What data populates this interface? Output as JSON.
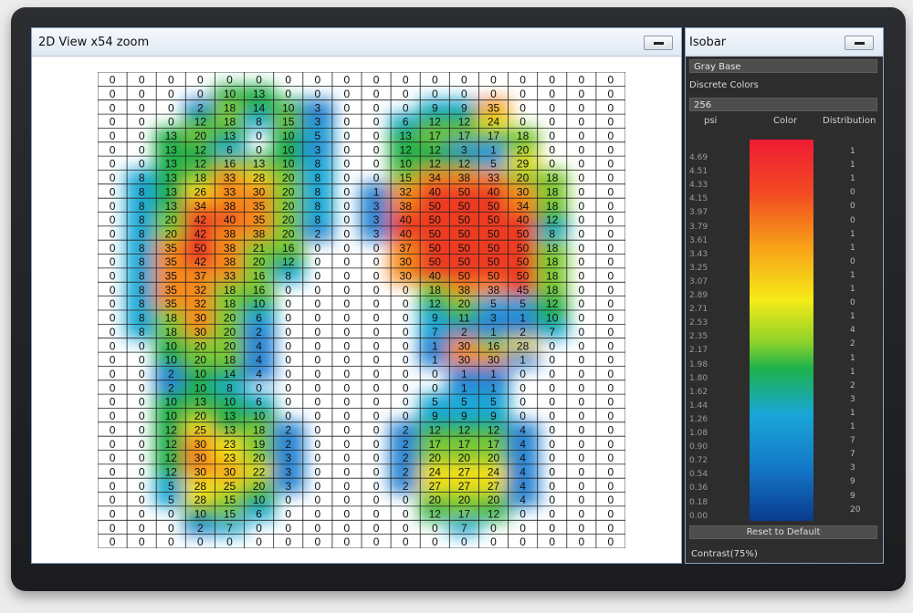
{
  "view_window": {
    "title": "2D View  x54 zoom",
    "grid": {
      "cols": 18,
      "left_region_cols": [
        0,
        8
      ],
      "rows": [
        [
          "0",
          "0",
          "0",
          "0",
          "0",
          "0",
          "0",
          "0",
          "0",
          "0",
          "0",
          "0",
          "0",
          "0",
          "0",
          "0",
          "0",
          "0"
        ],
        [
          "0",
          "0",
          "0",
          "0",
          "10",
          "13",
          "0",
          "0",
          "0",
          "0",
          "0",
          "0",
          "0",
          "0",
          "0",
          "0",
          "0",
          "0"
        ],
        [
          "0",
          "0",
          "0",
          "2",
          "18",
          "14",
          "10",
          "3",
          "0",
          "0",
          "0",
          "9",
          "9",
          "35",
          "0",
          "0",
          "0",
          "0"
        ],
        [
          "0",
          "0",
          "0",
          "12",
          "18",
          "8",
          "15",
          "3",
          "0",
          "0",
          "6",
          "12",
          "12",
          "24",
          "0",
          "0",
          "0",
          "0"
        ],
        [
          "0",
          "0",
          "13",
          "20",
          "13",
          "0",
          "10",
          "5",
          "0",
          "0",
          "13",
          "17",
          "17",
          "17",
          "18",
          "0",
          "0",
          "0"
        ],
        [
          "0",
          "0",
          "13",
          "12",
          "6",
          "0",
          "10",
          "3",
          "0",
          "0",
          "12",
          "12",
          "3",
          "1",
          "20",
          "0",
          "0",
          "0"
        ],
        [
          "0",
          "0",
          "13",
          "12",
          "16",
          "13",
          "10",
          "8",
          "0",
          "0",
          "10",
          "12",
          "12",
          "5",
          "29",
          "0",
          "0",
          "0"
        ],
        [
          "0",
          "8",
          "13",
          "18",
          "33",
          "28",
          "20",
          "8",
          "0",
          "0",
          "15",
          "34",
          "38",
          "33",
          "20",
          "18",
          "0",
          "0"
        ],
        [
          "0",
          "8",
          "13",
          "26",
          "33",
          "30",
          "20",
          "8",
          "0",
          "1",
          "32",
          "40",
          "50",
          "40",
          "30",
          "18",
          "0",
          "0"
        ],
        [
          "0",
          "8",
          "13",
          "34",
          "38",
          "35",
          "20",
          "8",
          "0",
          "3",
          "38",
          "50",
          "50",
          "50",
          "34",
          "18",
          "0",
          "0"
        ],
        [
          "0",
          "8",
          "20",
          "42",
          "40",
          "35",
          "20",
          "8",
          "0",
          "3",
          "40",
          "50",
          "50",
          "50",
          "40",
          "12",
          "0",
          "0"
        ],
        [
          "0",
          "8",
          "20",
          "42",
          "38",
          "38",
          "20",
          "2",
          "0",
          "3",
          "40",
          "50",
          "50",
          "50",
          "50",
          "8",
          "0",
          "0"
        ],
        [
          "0",
          "8",
          "35",
          "50",
          "38",
          "21",
          "16",
          "0",
          "0",
          "0",
          "37",
          "50",
          "50",
          "50",
          "50",
          "18",
          "0",
          "0"
        ],
        [
          "0",
          "8",
          "35",
          "42",
          "38",
          "20",
          "12",
          "0",
          "0",
          "0",
          "30",
          "50",
          "50",
          "50",
          "50",
          "18",
          "0",
          "0"
        ],
        [
          "0",
          "8",
          "35",
          "37",
          "33",
          "16",
          "8",
          "0",
          "0",
          "0",
          "30",
          "40",
          "50",
          "50",
          "50",
          "18",
          "0",
          "0"
        ],
        [
          "0",
          "8",
          "35",
          "32",
          "18",
          "16",
          "0",
          "0",
          "0",
          "0",
          "0",
          "18",
          "38",
          "38",
          "45",
          "18",
          "0",
          "0"
        ],
        [
          "0",
          "8",
          "35",
          "32",
          "18",
          "10",
          "0",
          "0",
          "0",
          "0",
          "0",
          "12",
          "20",
          "5",
          "5",
          "12",
          "0",
          "0"
        ],
        [
          "0",
          "8",
          "18",
          "30",
          "20",
          "6",
          "0",
          "0",
          "0",
          "0",
          "0",
          "9",
          "11",
          "3",
          "1",
          "10",
          "0",
          "0"
        ],
        [
          "0",
          "8",
          "18",
          "30",
          "20",
          "2",
          "0",
          "0",
          "0",
          "0",
          "0",
          "7",
          "2",
          "1",
          "2",
          "7",
          "0",
          "0"
        ],
        [
          "0",
          "0",
          "10",
          "20",
          "20",
          "4",
          "0",
          "0",
          "0",
          "0",
          "0",
          "1",
          "30",
          "16",
          "28",
          "0",
          "0",
          "0"
        ],
        [
          "0",
          "0",
          "10",
          "20",
          "18",
          "4",
          "0",
          "0",
          "0",
          "0",
          "0",
          "1",
          "30",
          "30",
          "1",
          "0",
          "0",
          "0"
        ],
        [
          "0",
          "0",
          "2",
          "10",
          "14",
          "4",
          "0",
          "0",
          "0",
          "0",
          "0",
          "0",
          "1",
          "1",
          "0",
          "0",
          "0",
          "0"
        ],
        [
          "0",
          "0",
          "2",
          "10",
          "8",
          "0",
          "0",
          "0",
          "0",
          "0",
          "0",
          "0",
          "1",
          "1",
          "0",
          "0",
          "0",
          "0"
        ],
        [
          "0",
          "0",
          "10",
          "13",
          "10",
          "6",
          "0",
          "0",
          "0",
          "0",
          "0",
          "5",
          "5",
          "5",
          "0",
          "0",
          "0",
          "0"
        ],
        [
          "0",
          "0",
          "10",
          "20",
          "13",
          "10",
          "0",
          "0",
          "0",
          "0",
          "0",
          "9",
          "9",
          "9",
          "0",
          "0",
          "0",
          "0"
        ],
        [
          "0",
          "0",
          "12",
          "25",
          "13",
          "18",
          "2",
          "0",
          "0",
          "0",
          "2",
          "12",
          "12",
          "12",
          "4",
          "0",
          "0",
          "0"
        ],
        [
          "0",
          "0",
          "12",
          "30",
          "23",
          "19",
          "2",
          "0",
          "0",
          "0",
          "2",
          "17",
          "17",
          "17",
          "4",
          "0",
          "0",
          "0"
        ],
        [
          "0",
          "0",
          "12",
          "30",
          "23",
          "20",
          "3",
          "0",
          "0",
          "0",
          "2",
          "20",
          "20",
          "20",
          "4",
          "0",
          "0",
          "0"
        ],
        [
          "0",
          "0",
          "12",
          "30",
          "30",
          "22",
          "3",
          "0",
          "0",
          "0",
          "2",
          "24",
          "27",
          "24",
          "4",
          "0",
          "0",
          "0"
        ],
        [
          "0",
          "0",
          "5",
          "28",
          "25",
          "20",
          "3",
          "0",
          "0",
          "0",
          "2",
          "27",
          "27",
          "27",
          "4",
          "0",
          "0",
          "0"
        ],
        [
          "0",
          "0",
          "5",
          "28",
          "15",
          "10",
          "0",
          "0",
          "0",
          "0",
          "0",
          "20",
          "20",
          "20",
          "4",
          "0",
          "0",
          "0"
        ],
        [
          "0",
          "0",
          "0",
          "10",
          "15",
          "6",
          "0",
          "0",
          "0",
          "0",
          "0",
          "12",
          "17",
          "12",
          "0",
          "0",
          "0",
          "0"
        ],
        [
          "0",
          "0",
          "0",
          "2",
          "7",
          "0",
          "0",
          "0",
          "0",
          "0",
          "0",
          "0",
          "7",
          "0",
          "0",
          "0",
          "0",
          "0"
        ],
        [
          "0",
          "0",
          "0",
          "0",
          "0",
          "0",
          "0",
          "0",
          "0",
          "0",
          "0",
          "0",
          "0",
          "0",
          "0",
          "0",
          "0",
          "0"
        ]
      ]
    }
  },
  "isobar": {
    "title": "Isobar",
    "base_mode": "Gray Base",
    "discrete_colors_label": "Discrete Colors",
    "discrete_colors_value": "256",
    "col_psi": "psi",
    "col_color": "Color",
    "col_distribution": "Distribution",
    "ticks": [
      "4.69",
      "4.51",
      "4.33",
      "4.15",
      "3.97",
      "3.79",
      "3.61",
      "3.43",
      "3.25",
      "3.07",
      "2.89",
      "2.71",
      "2.53",
      "2.35",
      "2.17",
      "1.98",
      "1.80",
      "1.62",
      "1.44",
      "1.26",
      "1.08",
      "0.90",
      "0.72",
      "0.54",
      "0.36",
      "0.18",
      "0.00"
    ],
    "distribution": [
      "1",
      "1",
      "1",
      "0",
      "0",
      "0",
      "1",
      "1",
      "0",
      "1",
      "1",
      "0",
      "1",
      "4",
      "2",
      "1",
      "1",
      "2",
      "3",
      "1",
      "1",
      "7",
      "7",
      "3",
      "9",
      "9",
      "20"
    ],
    "reset_label": "Reset to Default",
    "contrast_label": "Contrast(75%)",
    "gradient_colors": [
      "#ef1b34",
      "#f7a018",
      "#f6ea17",
      "#1db24a",
      "#19a6d8",
      "#0a3b8f"
    ]
  }
}
